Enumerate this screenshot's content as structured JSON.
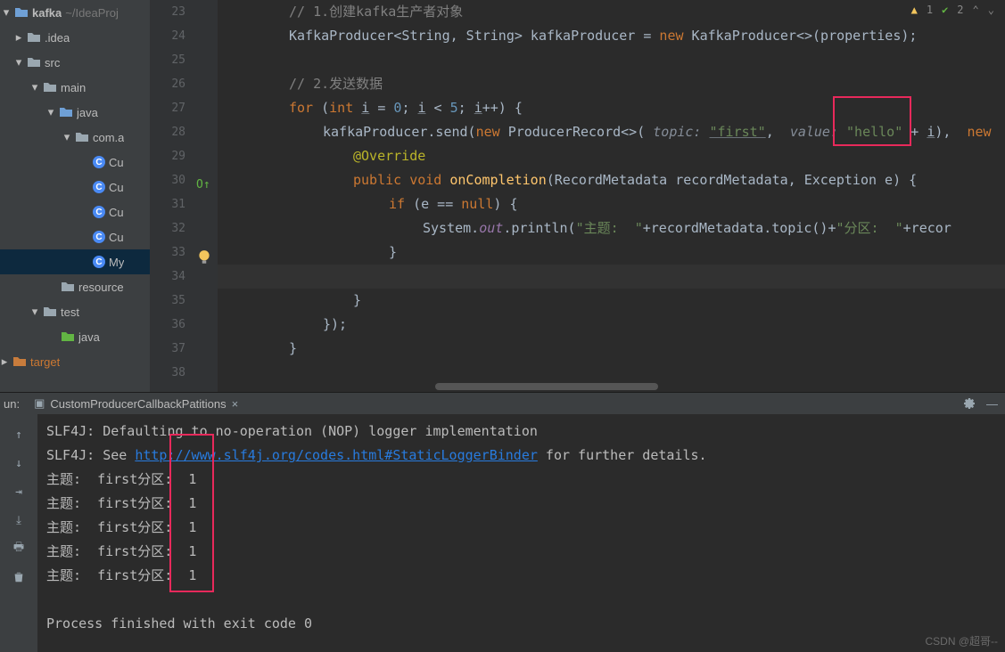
{
  "tree": {
    "project": "kafka",
    "projectPath": "~/IdeaProj",
    "idea": ".idea",
    "src": "src",
    "main": "main",
    "java": "java",
    "pkg": "com.a",
    "f1": "Cu",
    "f2": "Cu",
    "f3": "Cu",
    "f4": "Cu",
    "f5": "My",
    "resources": "resource",
    "test": "test",
    "testJava": "java",
    "target": "target"
  },
  "lineNums": [
    "23",
    "24",
    "25",
    "26",
    "27",
    "28",
    "29",
    "30",
    "31",
    "32",
    "33",
    "34",
    "35",
    "36",
    "37",
    "38"
  ],
  "code": {
    "l23_cmt": "// 1.创建kafka生产者对象",
    "l24_a": "KafkaProducer<String, String> kafkaProducer = ",
    "l24_new": "new",
    "l24_b": " KafkaProducer<>(properties);",
    "l26_cmt": "// 2.发送数据",
    "l27_for": "for",
    "l27_int": "int",
    "l27_a": " (",
    "l27_b": " ",
    "l27_i1": "i",
    "l27_c": " = ",
    "l27_n0": "0",
    "l27_d": "; ",
    "l27_i2": "i",
    "l27_e": " < ",
    "l27_n5": "5",
    "l27_f": "; ",
    "l27_i3": "i",
    "l27_g": "++) {",
    "l28_a": "kafkaProducer.send(",
    "l28_new": "new",
    "l28_b": " ProducerRecord<>( ",
    "l28_ht": "topic:",
    "l28_s1": "\"first\"",
    "l28_c": ", ",
    "l28_hv": "value:",
    "l28_s2": "\"hello\"",
    "l28_d": " + ",
    "l28_i": "i",
    "l28_e": "), ",
    "l28_new2": "new",
    "l29_ann": "@Override",
    "l30_pub": "public",
    "l30_void": "void",
    "l30_fn": "onCompletion",
    "l30_args": "(RecordMetadata recordMetadata, Exception e) {",
    "l31_if": "if",
    "l31_a": " (e == ",
    "l31_null": "null",
    "l31_b": ") {",
    "l32_a": "System.",
    "l32_out": "out",
    "l32_b": ".println(",
    "l32_s1": "\"主题:  \"",
    "l32_c": "+recordMetadata.topic()+",
    "l32_s2": "\"分区:  \"",
    "l32_d": "+recor",
    "l33_a": "}",
    "l35_a": "}",
    "l36_a": "});",
    "l37_a": "}"
  },
  "indicators": {
    "warn": "1",
    "ok": "2"
  },
  "console": {
    "toolLabel": "un:",
    "tabIcon": "exec-icon",
    "tabName": "CustomProducerCallbackPatitions",
    "l1": "SLF4J: Defaulting to no-operation (NOP) logger implementation",
    "l2a": "SLF4J: See ",
    "l2link": "http://www.slf4j.org/codes.html#StaticLoggerBinder",
    "l2b": " for further details.",
    "row": "主题:  first分区:  1",
    "exit": "Process finished with exit code 0"
  },
  "watermark": "CSDN @超哥--"
}
